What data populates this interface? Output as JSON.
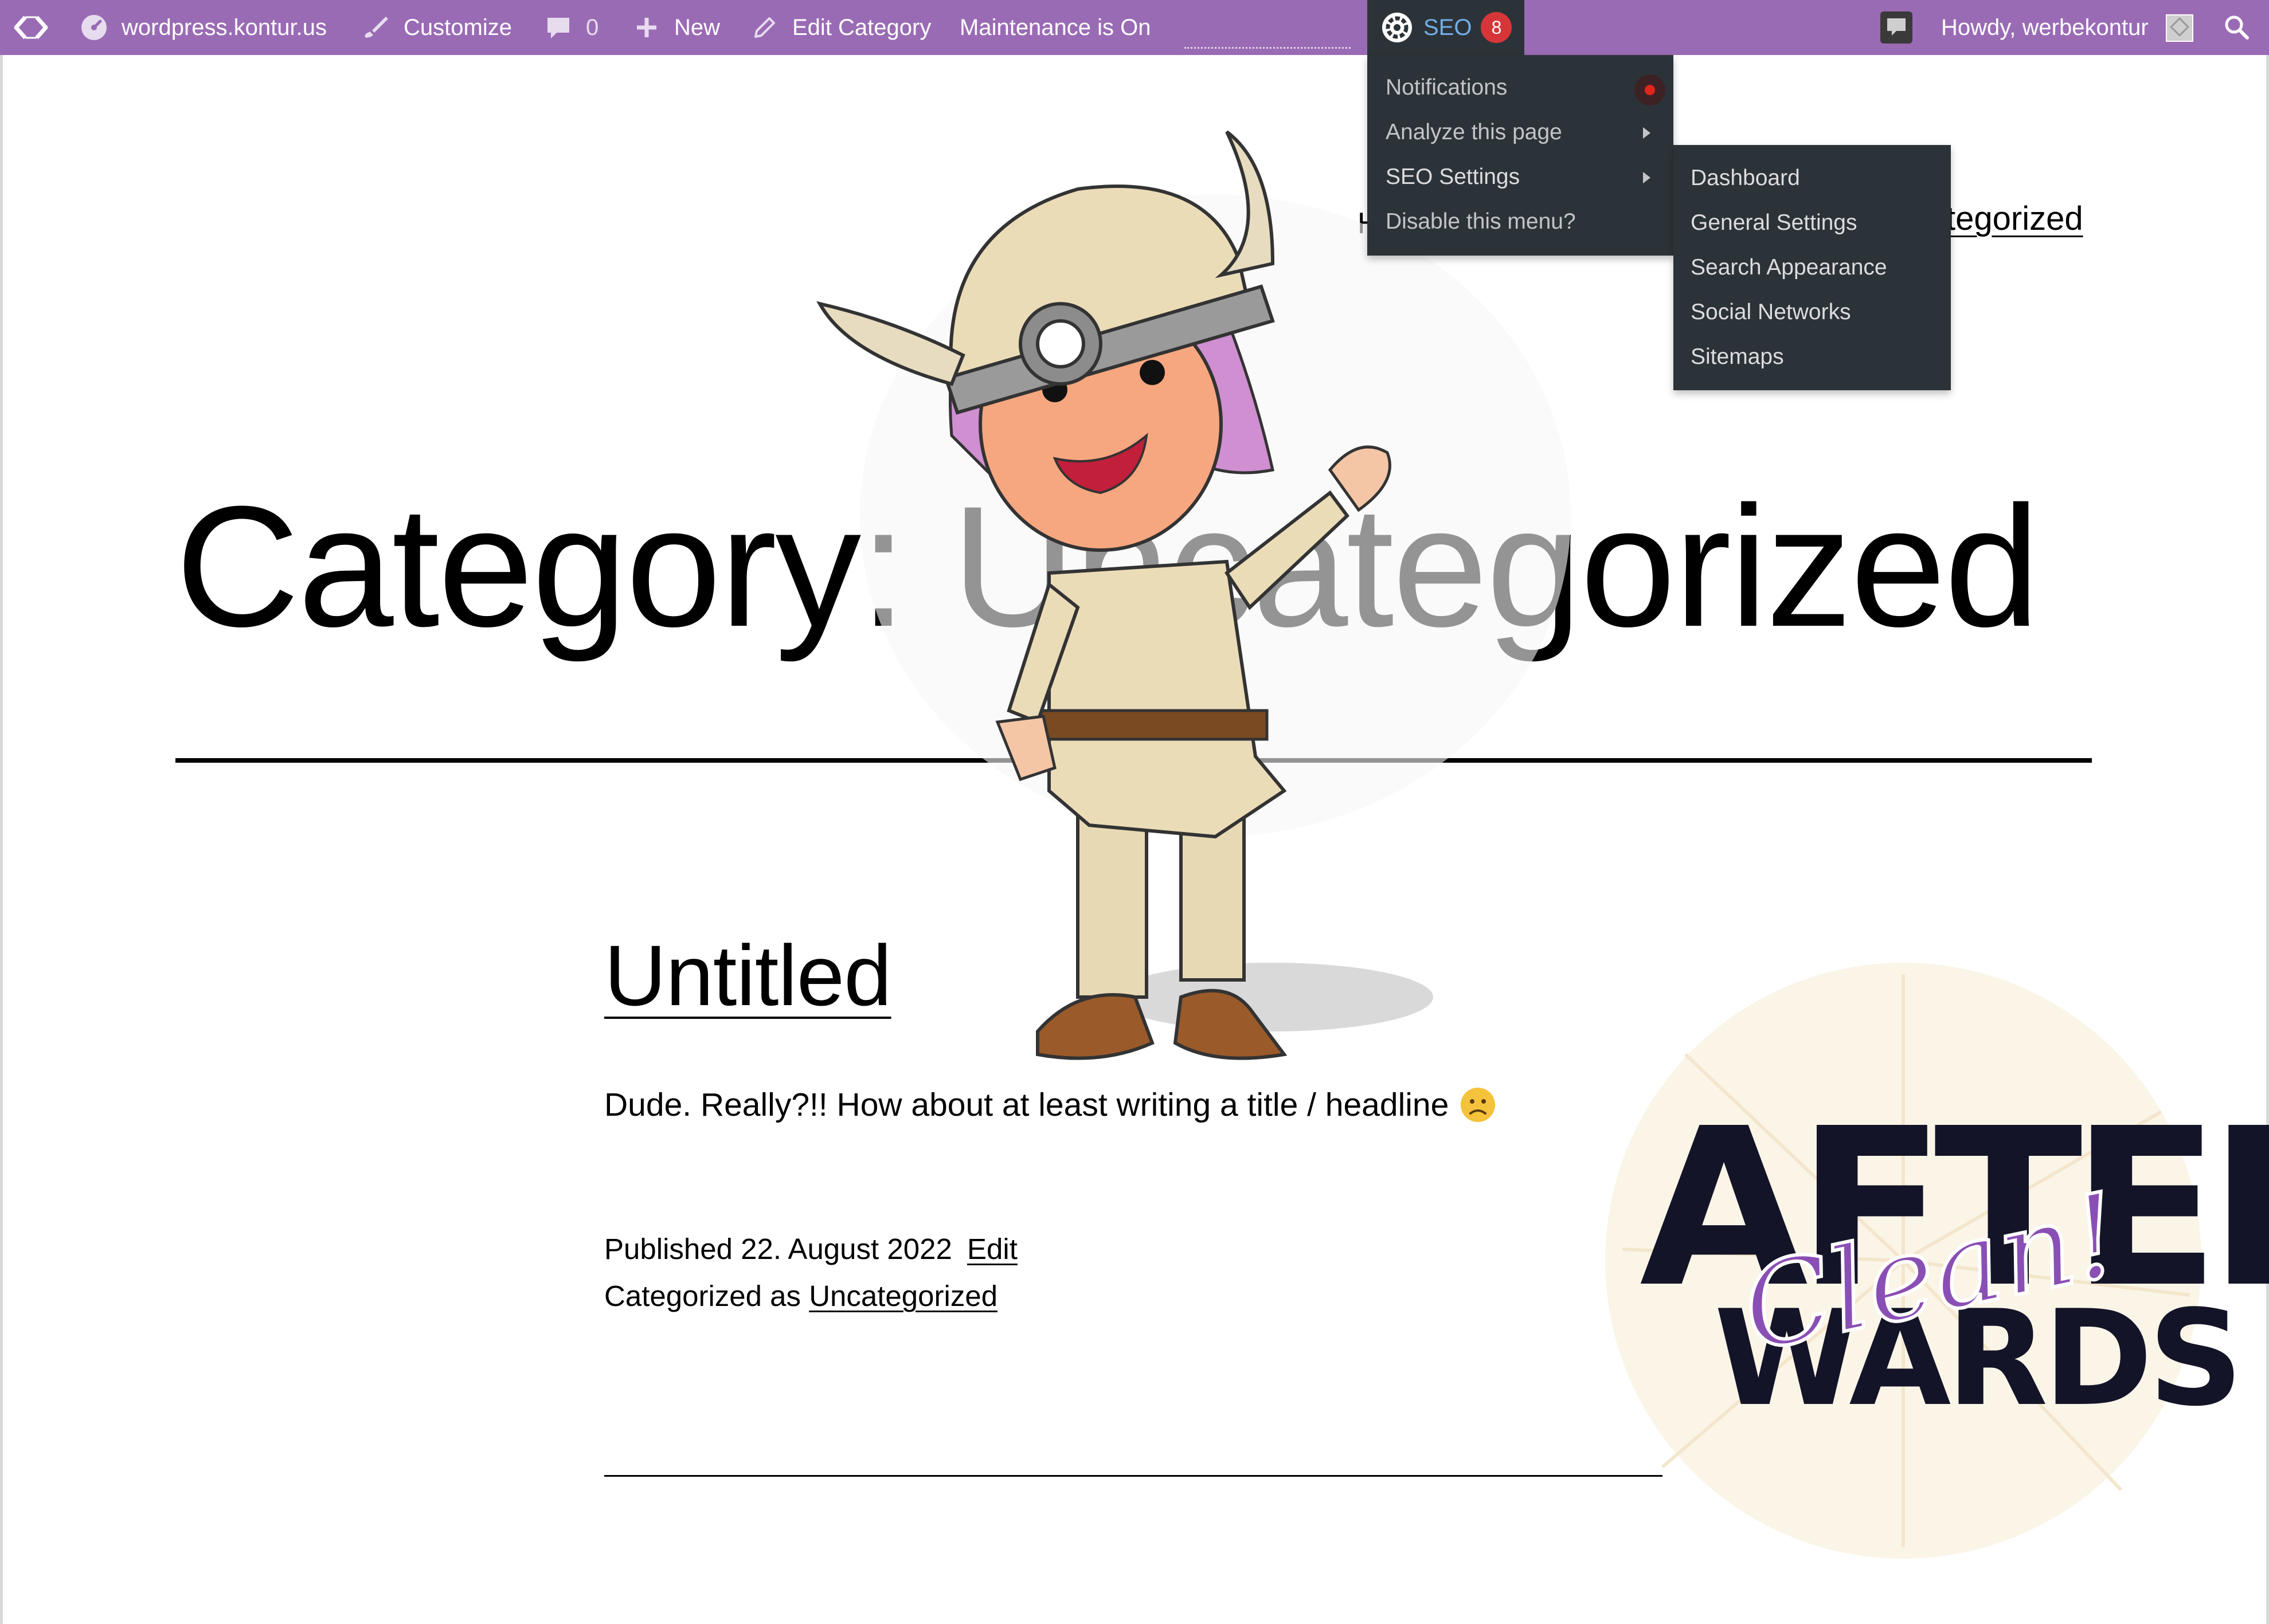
{
  "adminbar": {
    "site_name": "wordpress.kontur.us",
    "customize": "Customize",
    "comments_count": "0",
    "new": "New",
    "edit_category": "Edit Category",
    "maintenance": "Maintenance is On",
    "seo_label": "SEO",
    "seo_badge": "8",
    "howdy": "Howdy, werbekontur",
    "bar_color": "#9a6bb5",
    "menu_bg": "#2c3338"
  },
  "seo_menu": {
    "items": [
      "Notifications",
      "Analyze this page",
      "SEO Settings",
      "Disable this menu?"
    ],
    "submenu": [
      "Dashboard",
      "General Settings",
      "Search Appearance",
      "Social Networks",
      "Sitemaps"
    ]
  },
  "page": {
    "nav_fragment": "tegorized",
    "nav_h_fragment": "H",
    "archive_title": "Category: Uncategorized"
  },
  "post": {
    "title": "Untitled",
    "excerpt": "Dude. Really?!! How about at least writing a title / headline",
    "published_prefix": "Published",
    "published_date": "22. August 2022",
    "edit_link": "Edit",
    "categorized_prefix": "Categorized as",
    "category_link": "Uncategorized"
  },
  "overlay": {
    "after": "AFTER",
    "clean": "Clean!",
    "wards": "WARDS"
  }
}
